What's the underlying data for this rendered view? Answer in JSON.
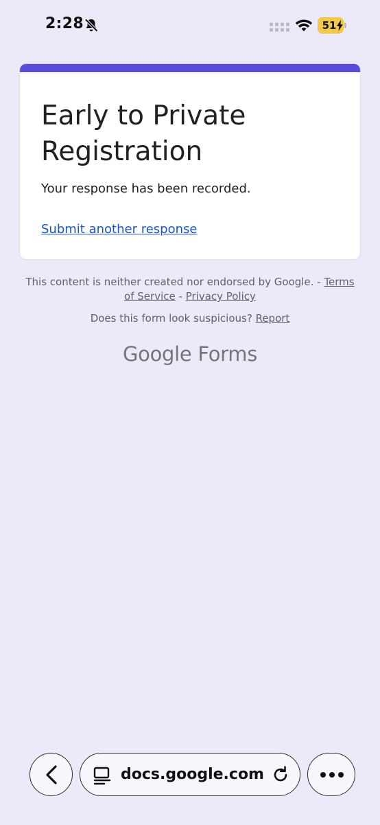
{
  "status_bar": {
    "time": "2:28",
    "battery_level": "51",
    "icons": [
      "bell-slash-icon",
      "signal-icon",
      "wifi-icon",
      "battery-charging-icon"
    ]
  },
  "form": {
    "title": "Early to Private Registration",
    "message": "Your response has been recorded.",
    "submit_another_label": "Submit another response",
    "accent_color": "#5B4BDB"
  },
  "footer": {
    "disclaimer": "This content is neither created nor endorsed by Google. -",
    "terms_label": "Terms of Service",
    "separator": "-",
    "privacy_label": "Privacy Policy",
    "suspicious_text": "Does this form look suspicious?",
    "report_label": "Report",
    "logo_google": "Google",
    "logo_forms": "Forms"
  },
  "browser": {
    "url": "docs.google.com",
    "icons": [
      "back-icon",
      "site-info-icon",
      "reload-icon",
      "more-icon"
    ]
  },
  "colors": {
    "background": "#ECEAF8",
    "link": "#1A55C9",
    "battery": "#F3C94A"
  }
}
